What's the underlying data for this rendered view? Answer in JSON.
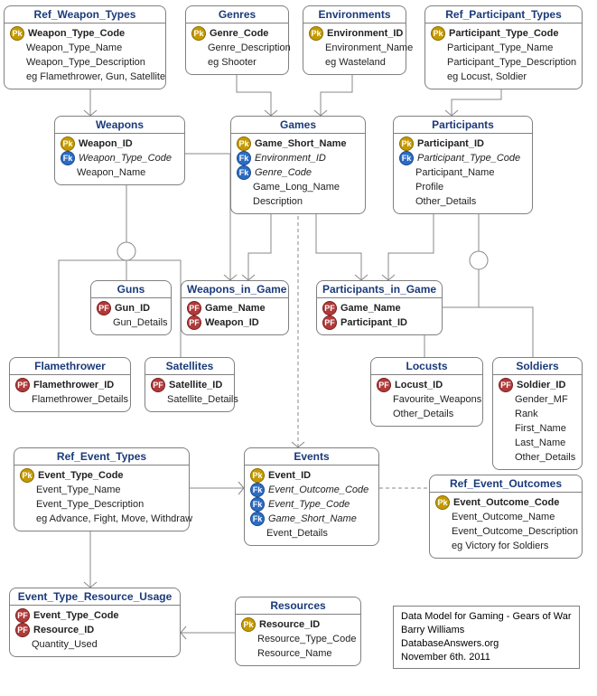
{
  "entities": {
    "ref_weapon_types": {
      "title": "Ref_Weapon_Types",
      "rows": [
        {
          "key": "pk",
          "label": "Weapon_Type_Code",
          "bold": true
        },
        {
          "key": "",
          "label": "Weapon_Type_Name"
        },
        {
          "key": "",
          "label": "Weapon_Type_Description"
        },
        {
          "key": "",
          "label": "eg Flamethrower, Gun, Satellite"
        }
      ]
    },
    "genres": {
      "title": "Genres",
      "rows": [
        {
          "key": "pk",
          "label": "Genre_Code",
          "bold": true
        },
        {
          "key": "",
          "label": "Genre_Description"
        },
        {
          "key": "",
          "label": "eg Shooter"
        }
      ]
    },
    "environments": {
      "title": "Environments",
      "rows": [
        {
          "key": "pk",
          "label": "Environment_ID",
          "bold": true
        },
        {
          "key": "",
          "label": "Environment_Name"
        },
        {
          "key": "",
          "label": "eg Wasteland"
        }
      ]
    },
    "ref_participant_types": {
      "title": "Ref_Participant_Types",
      "rows": [
        {
          "key": "pk",
          "label": "Participant_Type_Code",
          "bold": true
        },
        {
          "key": "",
          "label": "Participant_Type_Name"
        },
        {
          "key": "",
          "label": "Participant_Type_Description"
        },
        {
          "key": "",
          "label": "eg Locust, Soldier"
        }
      ]
    },
    "weapons": {
      "title": "Weapons",
      "rows": [
        {
          "key": "pk",
          "label": "Weapon_ID",
          "bold": true
        },
        {
          "key": "fk",
          "label": "Weapon_Type_Code",
          "italic": true
        },
        {
          "key": "",
          "label": "Weapon_Name"
        }
      ]
    },
    "games": {
      "title": "Games",
      "rows": [
        {
          "key": "pk",
          "label": "Game_Short_Name",
          "bold": true
        },
        {
          "key": "fk",
          "label": "Environment_ID",
          "italic": true
        },
        {
          "key": "fk",
          "label": "Genre_Code",
          "italic": true
        },
        {
          "key": "",
          "label": "Game_Long_Name"
        },
        {
          "key": "",
          "label": "Description"
        }
      ]
    },
    "participants": {
      "title": "Participants",
      "rows": [
        {
          "key": "pk",
          "label": "Participant_ID",
          "bold": true
        },
        {
          "key": "fk",
          "label": "Participant_Type_Code",
          "italic": true
        },
        {
          "key": "",
          "label": "Participant_Name"
        },
        {
          "key": "",
          "label": "Profile"
        },
        {
          "key": "",
          "label": "Other_Details"
        }
      ]
    },
    "guns": {
      "title": "Guns",
      "rows": [
        {
          "key": "pf",
          "label": "Gun_ID",
          "bold": true
        },
        {
          "key": "",
          "label": "Gun_Details"
        }
      ]
    },
    "weapons_in_game": {
      "title": "Weapons_in_Game",
      "rows": [
        {
          "key": "pf",
          "label": "Game_Name",
          "bold": true
        },
        {
          "key": "pf",
          "label": "Weapon_ID",
          "bold": true
        }
      ]
    },
    "participants_in_game": {
      "title": "Participants_in_Game",
      "rows": [
        {
          "key": "pf",
          "label": "Game_Name",
          "bold": true
        },
        {
          "key": "pf",
          "label": "Participant_ID",
          "bold": true
        }
      ]
    },
    "flamethrower": {
      "title": "Flamethrower",
      "rows": [
        {
          "key": "pf",
          "label": "Flamethrower_ID",
          "bold": true
        },
        {
          "key": "",
          "label": "Flamethrower_Details"
        }
      ]
    },
    "satellites": {
      "title": "Satellites",
      "rows": [
        {
          "key": "pf",
          "label": "Satellite_ID",
          "bold": true
        },
        {
          "key": "",
          "label": "Satellite_Details"
        }
      ]
    },
    "locusts": {
      "title": "Locusts",
      "rows": [
        {
          "key": "pf",
          "label": "Locust_ID",
          "bold": true
        },
        {
          "key": "",
          "label": "Favourite_Weapons"
        },
        {
          "key": "",
          "label": "Other_Details"
        }
      ]
    },
    "soldiers": {
      "title": "Soldiers",
      "rows": [
        {
          "key": "pf",
          "label": "Soldier_ID",
          "bold": true
        },
        {
          "key": "",
          "label": "Gender_MF"
        },
        {
          "key": "",
          "label": "Rank"
        },
        {
          "key": "",
          "label": "First_Name"
        },
        {
          "key": "",
          "label": "Last_Name"
        },
        {
          "key": "",
          "label": "Other_Details"
        }
      ]
    },
    "ref_event_types": {
      "title": "Ref_Event_Types",
      "rows": [
        {
          "key": "pk",
          "label": "Event_Type_Code",
          "bold": true
        },
        {
          "key": "",
          "label": "Event_Type_Name"
        },
        {
          "key": "",
          "label": "Event_Type_Description"
        },
        {
          "key": "",
          "label": "eg Advance, Fight, Move, Withdraw"
        }
      ]
    },
    "events": {
      "title": "Events",
      "rows": [
        {
          "key": "pk",
          "label": "Event_ID",
          "bold": true
        },
        {
          "key": "fk",
          "label": "Event_Outcome_Code",
          "italic": true
        },
        {
          "key": "fk",
          "label": "Event_Type_Code",
          "italic": true
        },
        {
          "key": "fk",
          "label": "Game_Short_Name",
          "italic": true
        },
        {
          "key": "",
          "label": "Event_Details"
        }
      ]
    },
    "ref_event_outcomes": {
      "title": "Ref_Event_Outcomes",
      "rows": [
        {
          "key": "pk",
          "label": "Event_Outcome_Code",
          "bold": true
        },
        {
          "key": "",
          "label": "Event_Outcome_Name"
        },
        {
          "key": "",
          "label": "Event_Outcome_Description"
        },
        {
          "key": "",
          "label": "eg Victory for Soldiers"
        }
      ]
    },
    "event_type_resource_usage": {
      "title": "Event_Type_Resource_Usage",
      "rows": [
        {
          "key": "pf",
          "label": "Event_Type_Code",
          "bold": true
        },
        {
          "key": "pf",
          "label": "Resource_ID",
          "bold": true
        },
        {
          "key": "",
          "label": "Quantity_Used"
        }
      ]
    },
    "resources": {
      "title": "Resources",
      "rows": [
        {
          "key": "pk",
          "label": "Resource_ID",
          "bold": true
        },
        {
          "key": "",
          "label": "Resource_Type_Code"
        },
        {
          "key": "",
          "label": "Resource_Name"
        }
      ]
    }
  },
  "caption": {
    "l1": "Data Model for Gaming - Gears of War",
    "l2": "Barry Williams",
    "l3": "DatabaseAnswers.org",
    "l4": "November 6th. 2011"
  }
}
